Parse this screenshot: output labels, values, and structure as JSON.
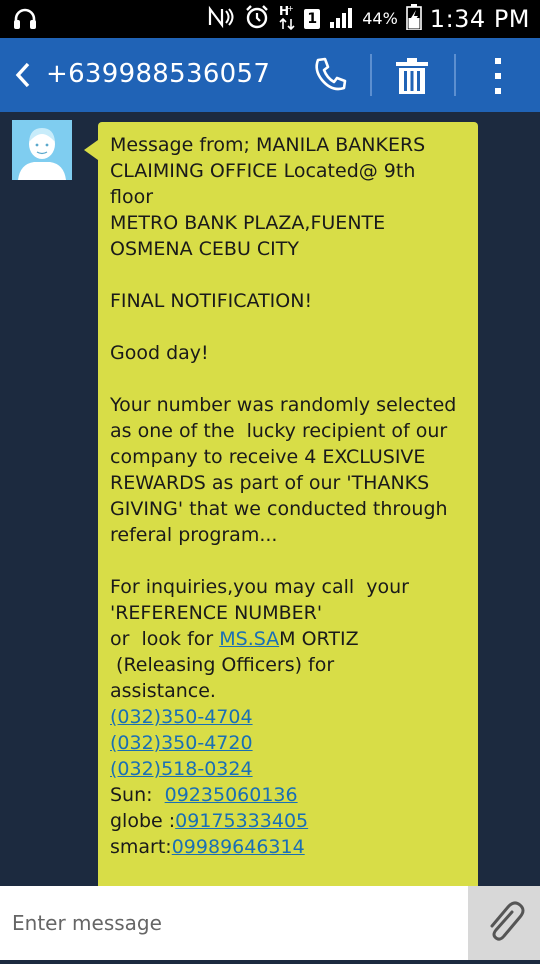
{
  "status_bar": {
    "battery_percent": "44%",
    "time": "1:34 PM",
    "sim_label": "1",
    "icons": [
      "headset-icon",
      "nfc-icon",
      "alarm-icon",
      "hplus-data-icon",
      "sim-icon",
      "signal-icon",
      "battery-icon"
    ]
  },
  "app_bar": {
    "contact_number": "+639988536057",
    "background": "#2063b6",
    "icons": [
      "back-arrow-icon",
      "phone-icon",
      "trash-icon",
      "more-vert-icon"
    ]
  },
  "message": {
    "bubble_color": "#d8dd47",
    "line1": "Message from; MANILA BANKERS",
    "line2": "CLAIMING OFFICE Located@ 9th",
    "line3": "floor",
    "line4": "METRO BANK PLAZA,FUENTE",
    "line5": "OSMENA CEBU CITY",
    "line6": "FINAL NOTIFICATION!",
    "line7": "Good day!",
    "line8": "Your number was randomly selected",
    "line9": "as one of the  lucky recipient of our",
    "line10": "company to receive 4 EXCLUSIVE",
    "line11": "REWARDS as part of our 'THANKS",
    "line12": "GIVING' that we conducted through",
    "line13": "referal program...",
    "line14": "For inquiries,you may call  your",
    "line15": "'REFERENCE NUMBER'",
    "line16_pre": "or  look for ",
    "line16_link": "MS.SA",
    "line16_post": "M ORTIZ",
    "line17": " (Releasing Officers) for",
    "line18": "assistance.",
    "phone1": "(032)350-4704",
    "phone2": "(032)350-4720",
    "phone3": "(032)518-0324",
    "sun_label": "Sun:  ",
    "sun_number": "09235060136",
    "globe_label": "globe :",
    "globe_number": "09175333405",
    "smart_label": "smart:",
    "smart_number": "09989646314"
  },
  "composer": {
    "placeholder": "Enter message",
    "attach_icon": "paperclip-icon"
  }
}
